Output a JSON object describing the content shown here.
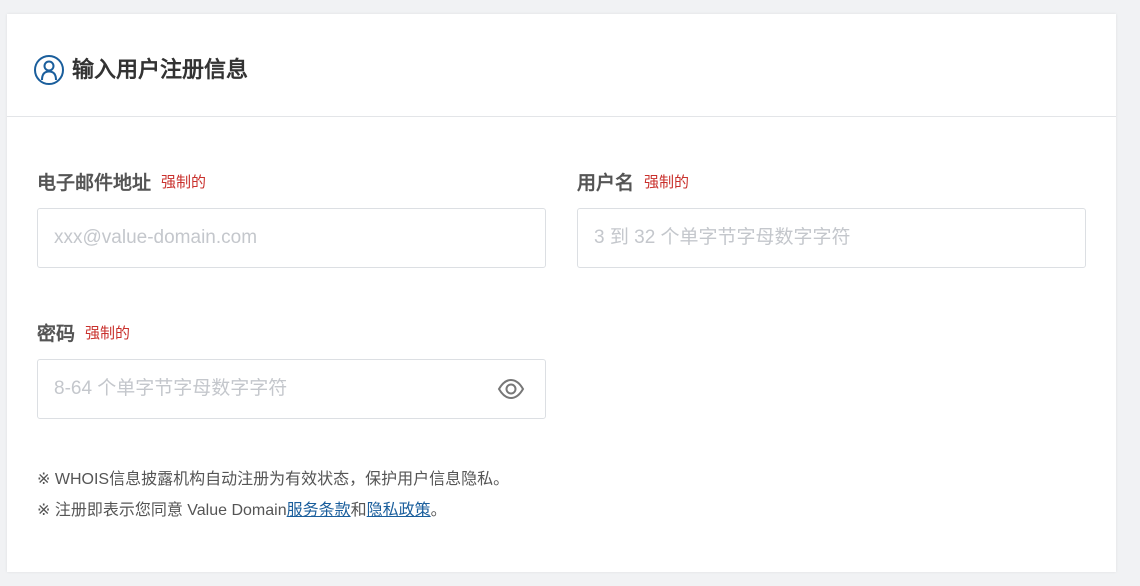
{
  "header": {
    "title": "输入用户注册信息",
    "icon": "user-circle-icon"
  },
  "fields": {
    "email": {
      "label": "电子邮件地址",
      "required": "强制的",
      "placeholder": "xxx@value-domain.com",
      "value": ""
    },
    "username": {
      "label": "用户名",
      "required": "强制的",
      "placeholder": "3 到 32 个单字节字母数字字符",
      "value": ""
    },
    "password": {
      "label": "密码",
      "required": "强制的",
      "placeholder": "8-64 个单字节字母数字字符",
      "value": "",
      "toggle_icon": "eye-icon"
    }
  },
  "notes": {
    "line1": "※ WHOIS信息披露机构自动注册为有效状态，保护用户信息隐私。",
    "line2_prefix": "※ 注册即表示您同意 Value Domain",
    "terms_link": "服务条款",
    "conjunction": "和",
    "privacy_link": "隐私政策",
    "line2_suffix": "。"
  },
  "colors": {
    "accent": "#1a5e9c",
    "required": "#c9302c",
    "background": "#f1f2f4"
  }
}
